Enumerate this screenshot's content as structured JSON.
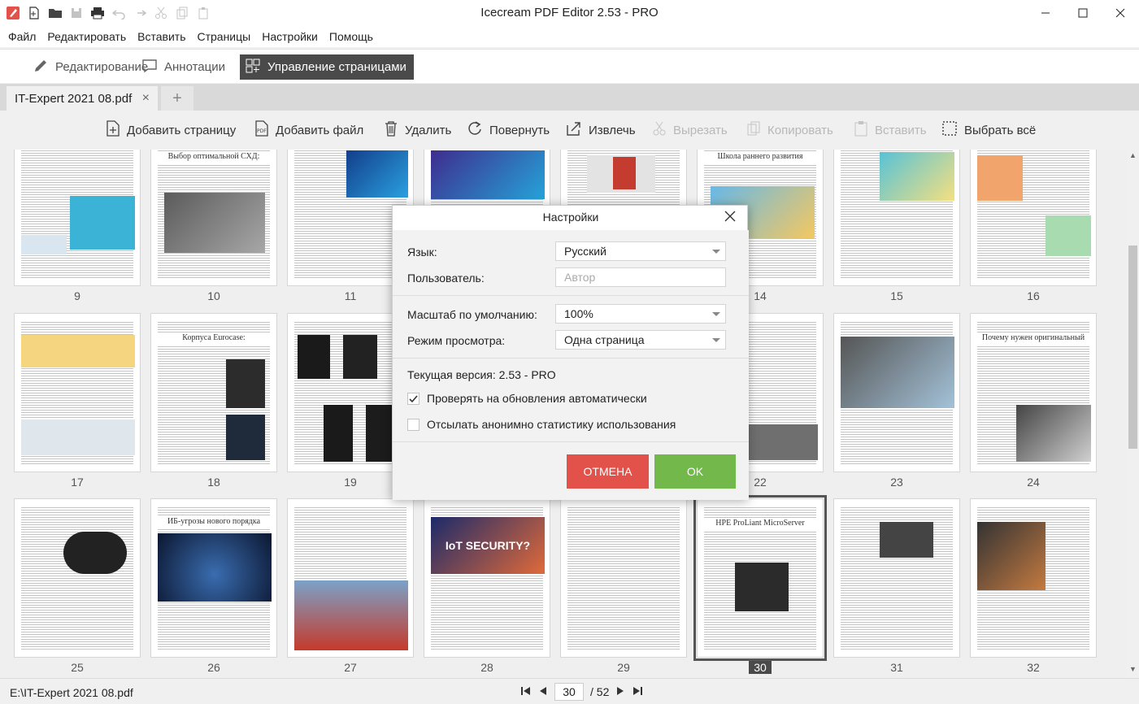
{
  "window": {
    "title": "Icecream PDF Editor 2.53 - PRO"
  },
  "menu": [
    "Файл",
    "Редактировать",
    "Вставить",
    "Страницы",
    "Настройки",
    "Помощь"
  ],
  "modes": [
    {
      "label": "Редактирование",
      "icon": "pencil-icon"
    },
    {
      "label": "Аннотации",
      "icon": "comment-icon"
    },
    {
      "label": "Управление страницами",
      "icon": "pages-grid-icon",
      "active": true
    }
  ],
  "tab": {
    "name": "IT-Expert 2021 08.pdf",
    "close": "×",
    "new": "+"
  },
  "pagetoolbar": {
    "add_page": "Добавить страницу",
    "add_file": "Добавить файл",
    "delete": "Удалить",
    "rotate": "Повернуть",
    "extract": "Извлечь",
    "cut": "Вырезать",
    "copy": "Копировать",
    "paste": "Вставить",
    "select_all": "Выбрать всё"
  },
  "thumbnails": {
    "row1": [
      "9",
      "10",
      "11",
      "",
      "",
      "",
      "14",
      "15",
      "16"
    ],
    "row2": [
      "17",
      "18",
      "19",
      "",
      "",
      "",
      "22",
      "23",
      "24"
    ],
    "row3": [
      "25",
      "26",
      "27",
      "28",
      "29",
      "30",
      "31",
      "32"
    ],
    "headlines": {
      "p10": "Выбор оптимальной СХД:",
      "p14": "Школа раннего развития",
      "p18": "Корпуса Eurocase:",
      "p24": "Почему нужен оригинальный",
      "p26": "ИБ-угрозы нового порядка",
      "p30": "HPE ProLiant MicroServer",
      "p28": "IoT SECURITY?"
    },
    "selected": "30"
  },
  "status": {
    "filepath": "E:\\IT-Expert 2021 08.pdf",
    "current_page": "30",
    "total": "/ 52"
  },
  "dialog": {
    "title": "Настройки",
    "language_label": "Язык:",
    "language_value": "Русский",
    "user_label": "Пользователь:",
    "user_placeholder": "Автор",
    "zoom_label": "Масштаб по умолчанию:",
    "zoom_value": "100%",
    "view_label": "Режим просмотра:",
    "view_value": "Одна страница",
    "version": "Текущая версия: 2.53 - PRO",
    "check_updates": "Проверять на обновления автоматически",
    "check_updates_checked": true,
    "send_stats": "Отсылать анонимно статистику использования",
    "send_stats_checked": false,
    "cancel": "ОТМЕНА",
    "ok": "OK"
  },
  "colors": {
    "cancel": "#e2514a",
    "ok": "#72b84a",
    "active_mode": "#4a4a4a"
  }
}
